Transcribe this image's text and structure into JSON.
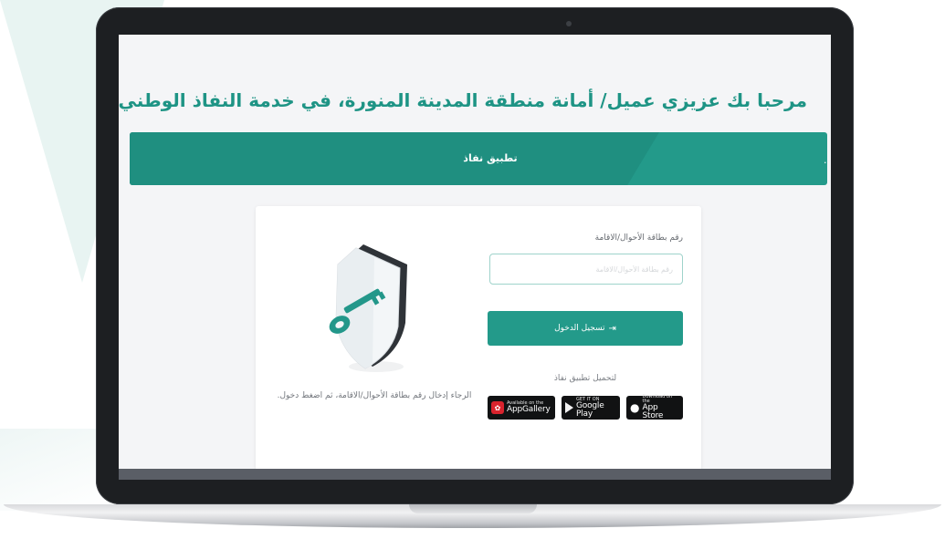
{
  "page": {
    "title": "مرحبا بك عزيزي عميل/ أمانة منطقة المدينة المنورة، في خدمة النفاذ الوطني الموحد"
  },
  "banner": {
    "title": "تطبيق نفاذ",
    "dot": "."
  },
  "login_form": {
    "id_label": "رقم بطاقة الأحوال/الاقامة",
    "id_placeholder": "رقم بطاقة الأحوال/الاقامة",
    "id_value": "",
    "login_button_label": "تسجيل الدخول",
    "login_icon": "login-arrow-icon"
  },
  "download": {
    "label": "لتحميل تطبيق نفاذ",
    "stores": [
      {
        "small": "Available on the",
        "big": "AppGallery",
        "icon": "huawei-icon"
      },
      {
        "small": "GET IT ON",
        "big": "Google Play",
        "icon": "google-play-icon"
      },
      {
        "small": "Download on the",
        "big": "App Store",
        "icon": "apple-icon"
      }
    ]
  },
  "instruction": {
    "text": "الرجاء إدخال رقم بطاقة الأحوال/الاقامة، ثم اضغط دخول."
  },
  "colors": {
    "brand": "#239a8a",
    "brand_dark": "#1f8f80",
    "title": "#1e9485",
    "screen_bg": "#f4f5f7",
    "laptop_frame": "#1d1f22"
  }
}
